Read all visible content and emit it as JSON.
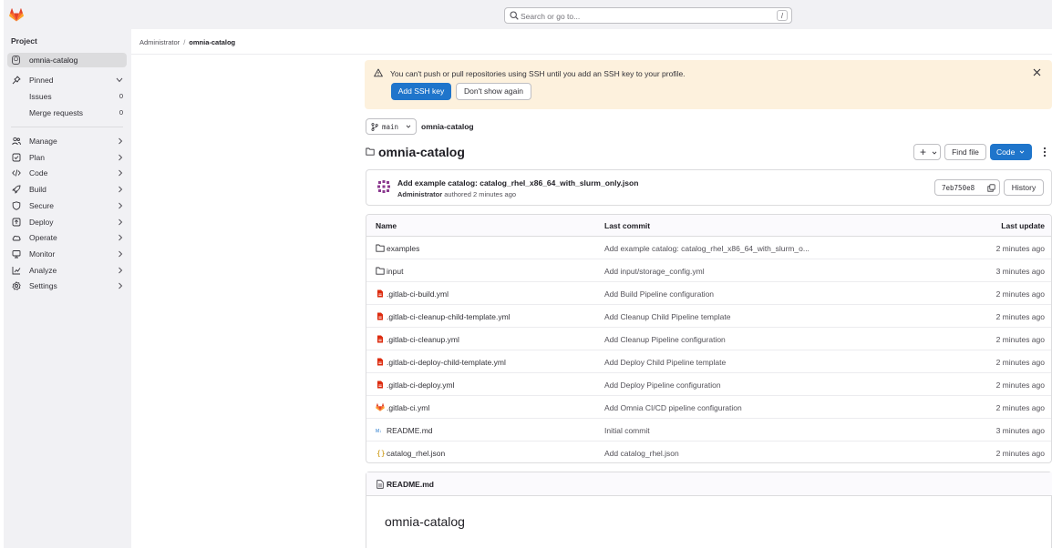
{
  "topbar": {
    "logo_icon": "gitlab-tanuki-icon",
    "search_placeholder": "Search or go to...",
    "search_shortcut": "/"
  },
  "sidebar": {
    "heading": "Project",
    "project": {
      "badge": "O",
      "label": "omnia-catalog"
    },
    "pinned": {
      "label": "Pinned"
    },
    "pinned_items": [
      {
        "label": "Issues",
        "count": "0"
      },
      {
        "label": "Merge requests",
        "count": "0"
      }
    ],
    "items": [
      {
        "label": "Manage",
        "icon": "users-icon"
      },
      {
        "label": "Plan",
        "icon": "plan-icon"
      },
      {
        "label": "Code",
        "icon": "code-icon"
      },
      {
        "label": "Build",
        "icon": "rocket-icon"
      },
      {
        "label": "Secure",
        "icon": "shield-icon"
      },
      {
        "label": "Deploy",
        "icon": "deploy-icon"
      },
      {
        "label": "Operate",
        "icon": "cloud-icon"
      },
      {
        "label": "Monitor",
        "icon": "monitor-icon"
      },
      {
        "label": "Analyze",
        "icon": "chart-icon"
      },
      {
        "label": "Settings",
        "icon": "gear-icon"
      }
    ]
  },
  "breadcrumb": {
    "parent": "Administrator",
    "separator": "/",
    "current": "omnia-catalog"
  },
  "alert": {
    "message": "You can't push or pull repositories using SSH until you add an SSH key to your profile.",
    "add_ssh_key": "Add SSH key",
    "dont_show": "Don't show again"
  },
  "repo": {
    "branch": "main",
    "path": "omnia-catalog",
    "title": "omnia-catalog",
    "plus_label": "+",
    "find_file": "Find file",
    "code": "Code"
  },
  "commit": {
    "title": "Add example catalog: catalog_rhel_x86_64_with_slurm_only.json",
    "author": "Administrator",
    "authored_text": "authored 2 minutes ago",
    "sha": "7eb750e8",
    "history": "History"
  },
  "table": {
    "headers": {
      "name": "Name",
      "last_commit": "Last commit",
      "last_update": "Last update"
    },
    "rows": [
      {
        "name": "examples",
        "type": "folder",
        "commit": "Add example catalog: catalog_rhel_x86_64_with_slurm_o...",
        "date": "2 minutes ago"
      },
      {
        "name": "input",
        "type": "folder",
        "commit": "Add input/storage_config.yml",
        "date": "3 minutes ago"
      },
      {
        "name": ".gitlab-ci-build.yml",
        "type": "yaml",
        "commit": "Add Build Pipeline configuration",
        "date": "2 minutes ago"
      },
      {
        "name": ".gitlab-ci-cleanup-child-template.yml",
        "type": "yaml",
        "commit": "Add Cleanup Child Pipeline template",
        "date": "2 minutes ago"
      },
      {
        "name": ".gitlab-ci-cleanup.yml",
        "type": "yaml",
        "commit": "Add Cleanup Pipeline configuration",
        "date": "2 minutes ago"
      },
      {
        "name": ".gitlab-ci-deploy-child-template.yml",
        "type": "yaml",
        "commit": "Add Deploy Child Pipeline template",
        "date": "2 minutes ago"
      },
      {
        "name": ".gitlab-ci-deploy.yml",
        "type": "yaml",
        "commit": "Add Deploy Pipeline configuration",
        "date": "2 minutes ago"
      },
      {
        "name": ".gitlab-ci.yml",
        "type": "gitlab",
        "commit": "Add Omnia CI/CD pipeline configuration",
        "date": "2 minutes ago"
      },
      {
        "name": "README.md",
        "type": "markdown",
        "commit": "Initial commit",
        "date": "3 minutes ago"
      },
      {
        "name": "catalog_rhel.json",
        "type": "json",
        "commit": "Add catalog_rhel.json",
        "date": "2 minutes ago"
      }
    ]
  },
  "readme": {
    "file": "README.md",
    "heading": "omnia-catalog"
  },
  "colors": {
    "primary": "#1f75cb",
    "sidebar_bg": "#f1f1f4",
    "alert_bg": "#fdf1dd",
    "yaml_red": "#dd2b0e",
    "gitlab_orange": "#fc6d26"
  }
}
